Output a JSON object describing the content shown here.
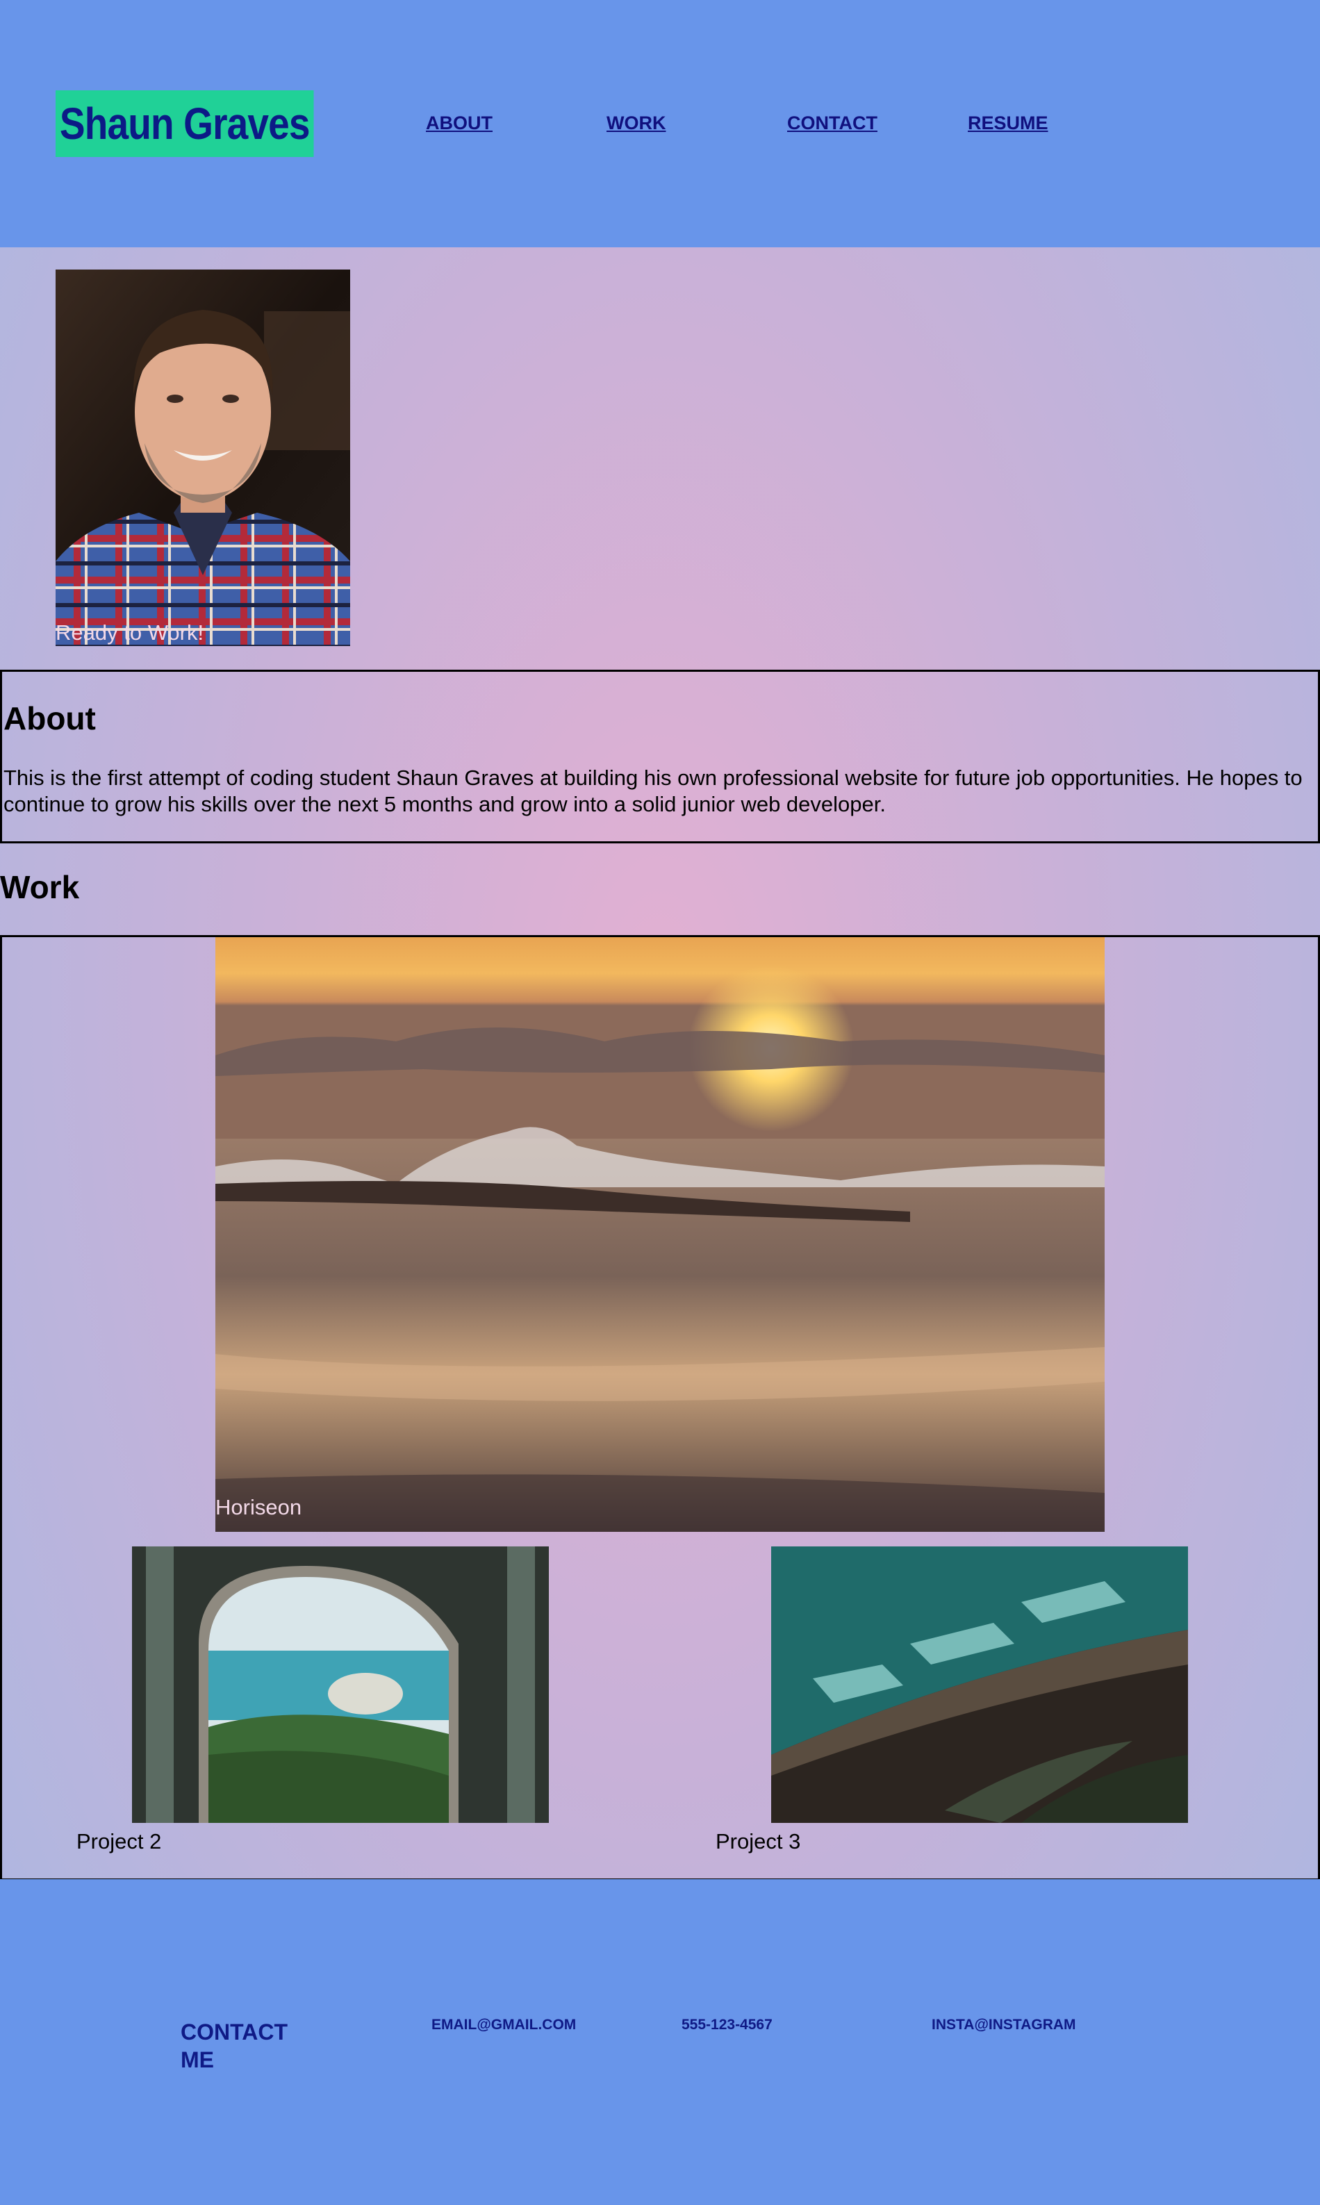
{
  "header": {
    "logo": "Shaun Graves",
    "nav": [
      "ABOUT",
      "WORK",
      "CONTACT",
      "RESUME"
    ]
  },
  "hero": {
    "caption": "Ready to Work!"
  },
  "about": {
    "title": "About",
    "text": "This is the first attempt of coding student Shaun Graves at building his own professional website for future job opportunities. He hopes to continue to grow his skills over the next 5 months and grow into a solid junior web developer."
  },
  "work": {
    "title": "Work",
    "featured_caption": "Horiseon",
    "projects": [
      "Project 2",
      "Project 3"
    ]
  },
  "footer": {
    "contact_title": "CONTACT ME",
    "email": "EMAIL@GMAIL.COM",
    "phone": "555-123-4567",
    "insta": "INSTA@INSTAGRAM"
  },
  "colors": {
    "header_bg": "#6895ea",
    "logo_bg": "#20d197",
    "nav_text": "#10107e"
  }
}
